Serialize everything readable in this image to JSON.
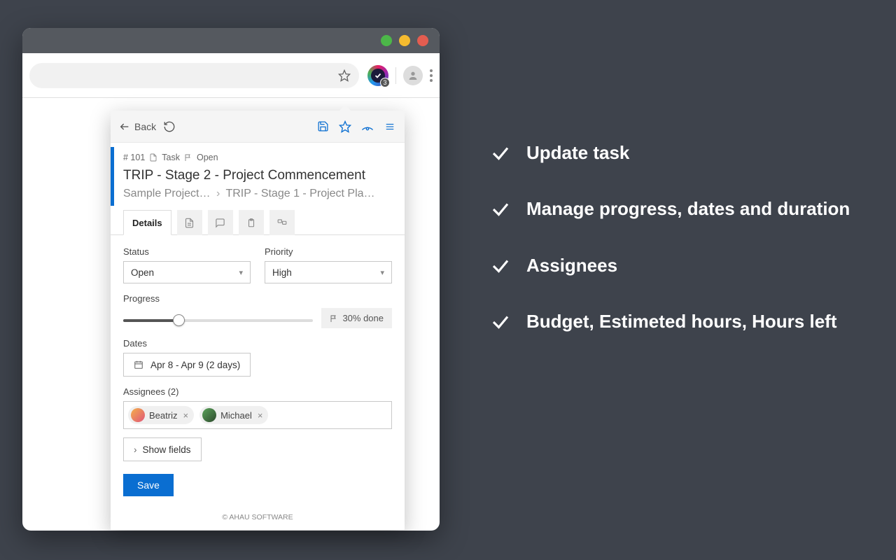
{
  "browser": {
    "ext_badge": "3"
  },
  "popup": {
    "back_label": "Back",
    "task_id": "# 101",
    "type_label": "Task",
    "status_chip": "Open",
    "title": "TRIP - Stage 2 - Project Commencement",
    "breadcrumb_a": "Sample Project…",
    "breadcrumb_b": "TRIP - Stage 1 - Project Pla…",
    "tabs": {
      "details": "Details"
    },
    "form": {
      "status_label": "Status",
      "status_value": "Open",
      "priority_label": "Priority",
      "priority_value": "High",
      "progress_label": "Progress",
      "progress_done": "30% done",
      "dates_label": "Dates",
      "dates_value": "Apr 8 - Apr 9 (2 days)",
      "assignees_label": "Assignees (2)",
      "assignees": [
        {
          "name": "Beatriz",
          "color1": "#f4b04a",
          "color2": "#e0557a"
        },
        {
          "name": "Michael",
          "color1": "#5aa35a",
          "color2": "#2d4a2d"
        }
      ],
      "show_fields": "Show fields",
      "save": "Save"
    },
    "footer": "© AHAU SOFTWARE"
  },
  "features": [
    "Update task",
    "Manage progress, dates and duration",
    "Assignees",
    "Budget, Estimeted hours, Hours left"
  ]
}
